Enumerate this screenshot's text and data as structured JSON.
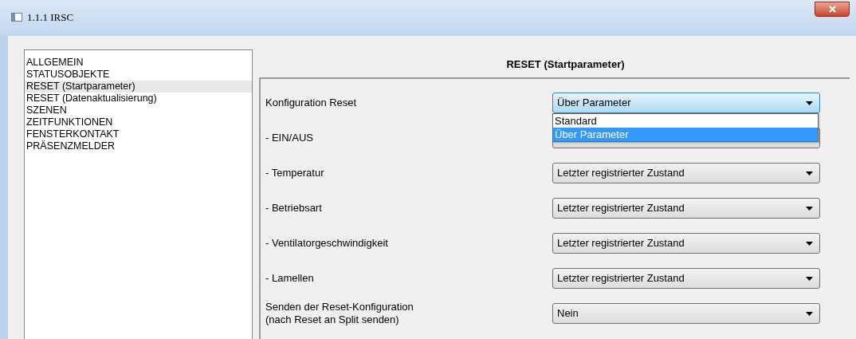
{
  "window": {
    "title": "1.1.1 IRSC"
  },
  "sidebar": {
    "items": [
      {
        "label": "ALLGEMEIN",
        "selected": false
      },
      {
        "label": "STATUSOBJEKTE",
        "selected": false
      },
      {
        "label": "RESET (Startparameter)",
        "selected": true
      },
      {
        "label": "RESET (Datenaktualisierung)",
        "selected": false
      },
      {
        "label": "SZENEN",
        "selected": false
      },
      {
        "label": "ZEITFUNKTIONEN",
        "selected": false
      },
      {
        "label": "FENSTERKONTAKT",
        "selected": false
      },
      {
        "label": "PRÄSENZMELDER",
        "selected": false
      }
    ]
  },
  "panel": {
    "title": "RESET (Startparameter)",
    "rows": [
      {
        "label": "Konfiguration Reset",
        "value": "Über Parameter",
        "expanded": true,
        "options": [
          {
            "label": "Standard",
            "selected": false
          },
          {
            "label": "Über Parameter",
            "selected": true
          }
        ]
      },
      {
        "label": "- EIN/AUS"
      },
      {
        "label": "- Temperatur",
        "value": "Letzter registrierter Zustand",
        "expanded": false
      },
      {
        "label": "- Betriebsart",
        "value": "Letzter registrierter Zustand",
        "expanded": false
      },
      {
        "label": "- Ventilatorgeschwindigkeit",
        "value": "Letzter registrierter Zustand",
        "expanded": false
      },
      {
        "label": "- Lamellen",
        "value": "Letzter registrierter Zustand",
        "expanded": false
      },
      {
        "label": "Senden der Reset-Konfiguration\n(nach Reset an Split senden)",
        "value": "Nein",
        "expanded": false
      }
    ]
  }
}
